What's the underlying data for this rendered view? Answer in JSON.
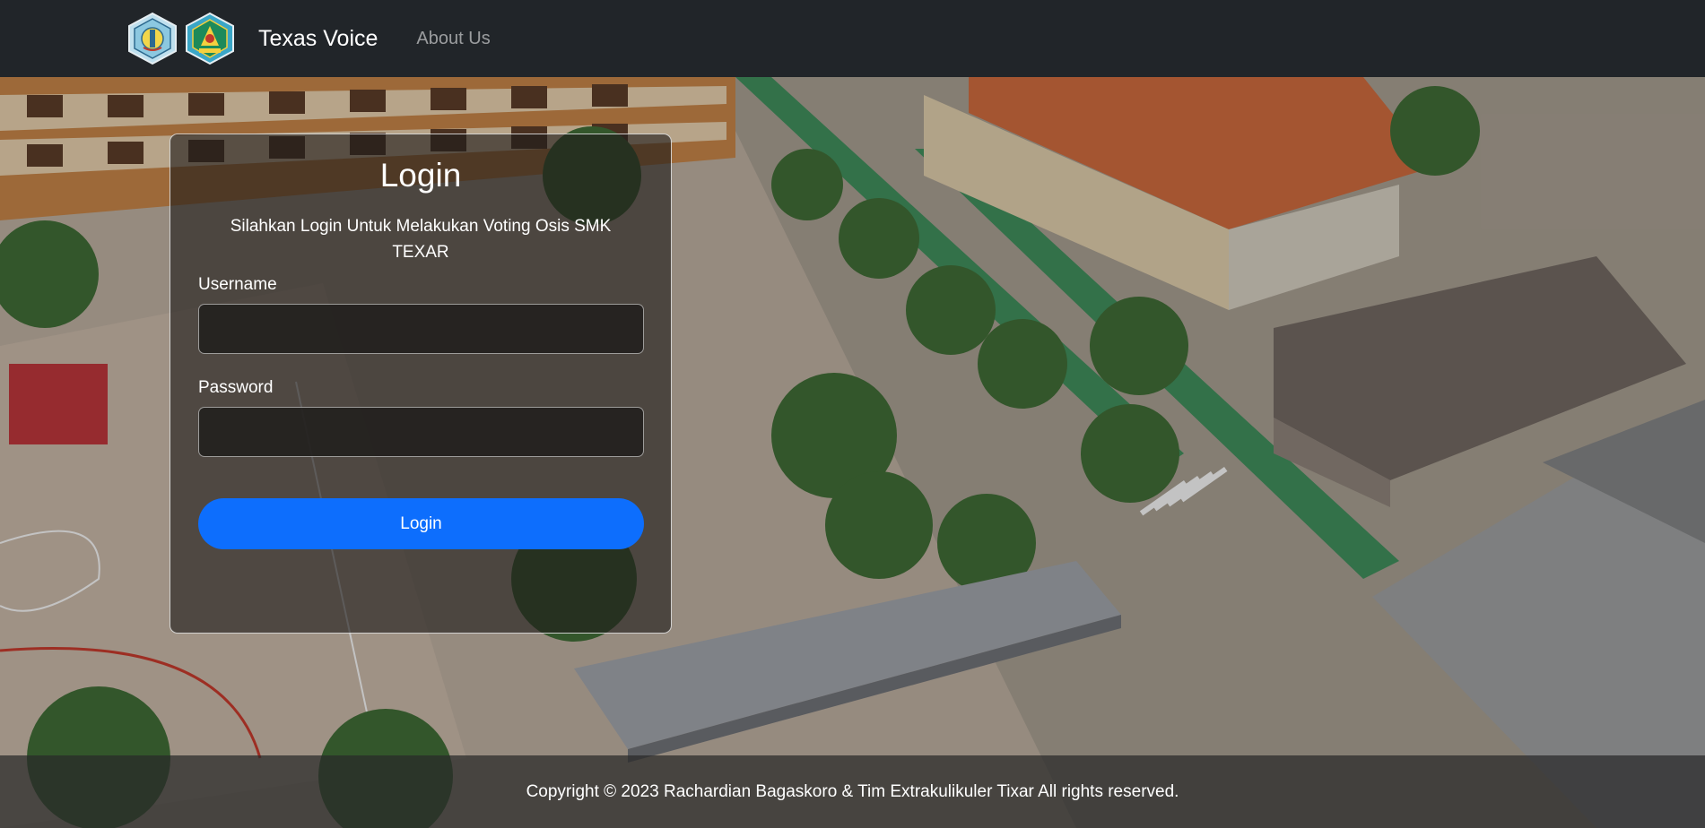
{
  "navbar": {
    "brand": "Texas Voice",
    "logos": [
      "school-logo-icon",
      "regional-emblem-icon"
    ],
    "links": [
      {
        "label": "About Us"
      }
    ]
  },
  "login": {
    "title": "Login",
    "subtitle": "Silahkan Login Untuk Melakukan Voting Osis SMK TEXAR",
    "username_label": "Username",
    "username_value": "",
    "password_label": "Password",
    "password_value": "",
    "button_label": "Login"
  },
  "footer": {
    "copyright": "Copyright © 2023 Rachardian Bagaskoro & Tim Extrakulikuler Tixar All rights reserved."
  },
  "colors": {
    "navbar_bg": "#212529",
    "primary_button": "#0d6efd",
    "nav_link": "rgba(255,255,255,0.55)"
  }
}
